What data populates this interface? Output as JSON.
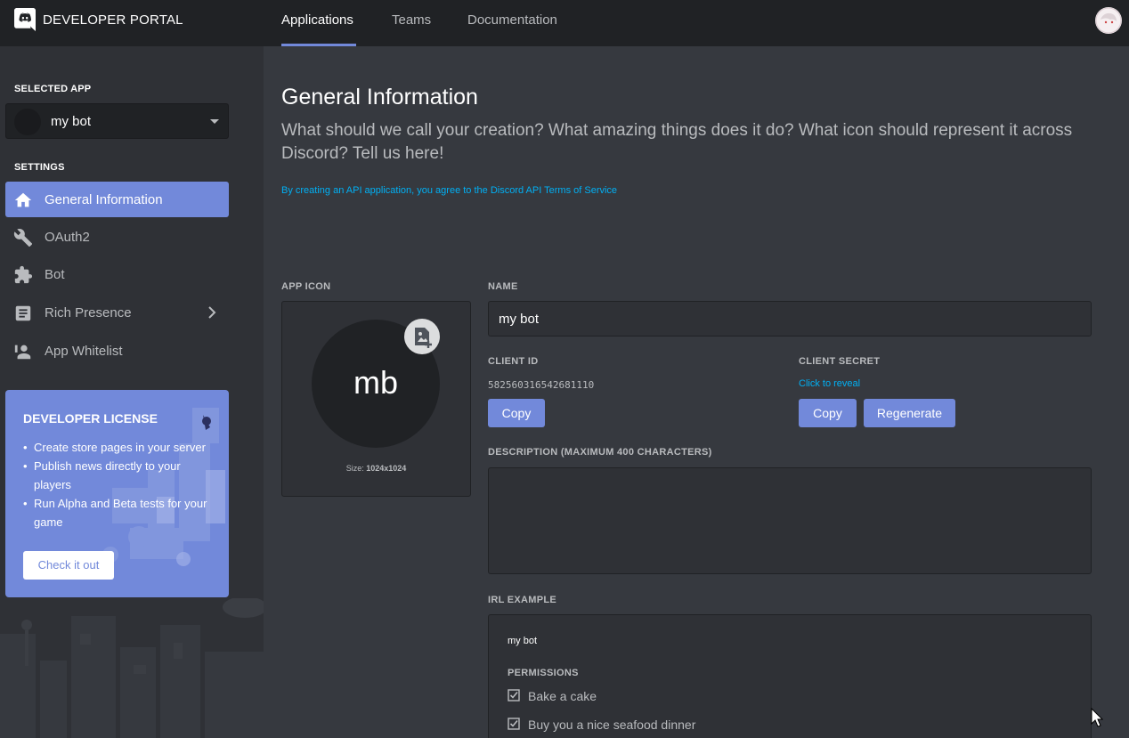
{
  "topbar": {
    "brand": "DEVELOPER PORTAL",
    "nav": [
      "Applications",
      "Teams",
      "Documentation"
    ],
    "active_nav": "Applications"
  },
  "sidebar": {
    "selected_app_heading": "SELECTED APP",
    "selected_app": "my bot",
    "settings_heading": "SETTINGS",
    "items": [
      {
        "label": "General Information",
        "icon": "home-icon",
        "active": true
      },
      {
        "label": "OAuth2",
        "icon": "wrench-icon",
        "active": false
      },
      {
        "label": "Bot",
        "icon": "puzzle-icon",
        "active": false
      },
      {
        "label": "Rich Presence",
        "icon": "document-icon",
        "active": false,
        "expandable": true
      },
      {
        "label": "App Whitelist",
        "icon": "person-icon",
        "active": false
      }
    ],
    "license": {
      "title": "DEVELOPER LICENSE",
      "bullets": [
        "Create store pages in your server",
        "Publish news directly to your players",
        "Run Alpha and Beta tests for your game"
      ],
      "button": "Check it out"
    }
  },
  "main": {
    "title": "General Information",
    "subtitle": "What should we call your creation? What amazing things does it do? What icon should represent it across Discord? Tell us here!",
    "tos_link": "By creating an API application, you agree to the Discord API Terms of Service",
    "app_icon": {
      "label": "APP ICON",
      "initials": "mb",
      "size_prefix": "Size:",
      "size_value": "1024x1024"
    },
    "name": {
      "label": "NAME",
      "value": "my bot"
    },
    "client_id": {
      "label": "CLIENT ID",
      "value": "582560316542681110",
      "copy": "Copy"
    },
    "client_secret": {
      "label": "CLIENT SECRET",
      "reveal": "Click to reveal",
      "copy": "Copy",
      "regenerate": "Regenerate"
    },
    "description": {
      "label": "DESCRIPTION (MAXIMUM 400 CHARACTERS)",
      "value": ""
    },
    "irl": {
      "label": "IRL EXAMPLE",
      "name": "my bot",
      "permissions_label": "PERMISSIONS",
      "permissions": [
        "Bake a cake",
        "Buy you a nice seafood dinner"
      ]
    }
  },
  "colors": {
    "blurple": "#7289da",
    "link": "#00b0f4",
    "topbar": "#202225",
    "sidebar": "#2f3136",
    "main": "#36393f"
  }
}
